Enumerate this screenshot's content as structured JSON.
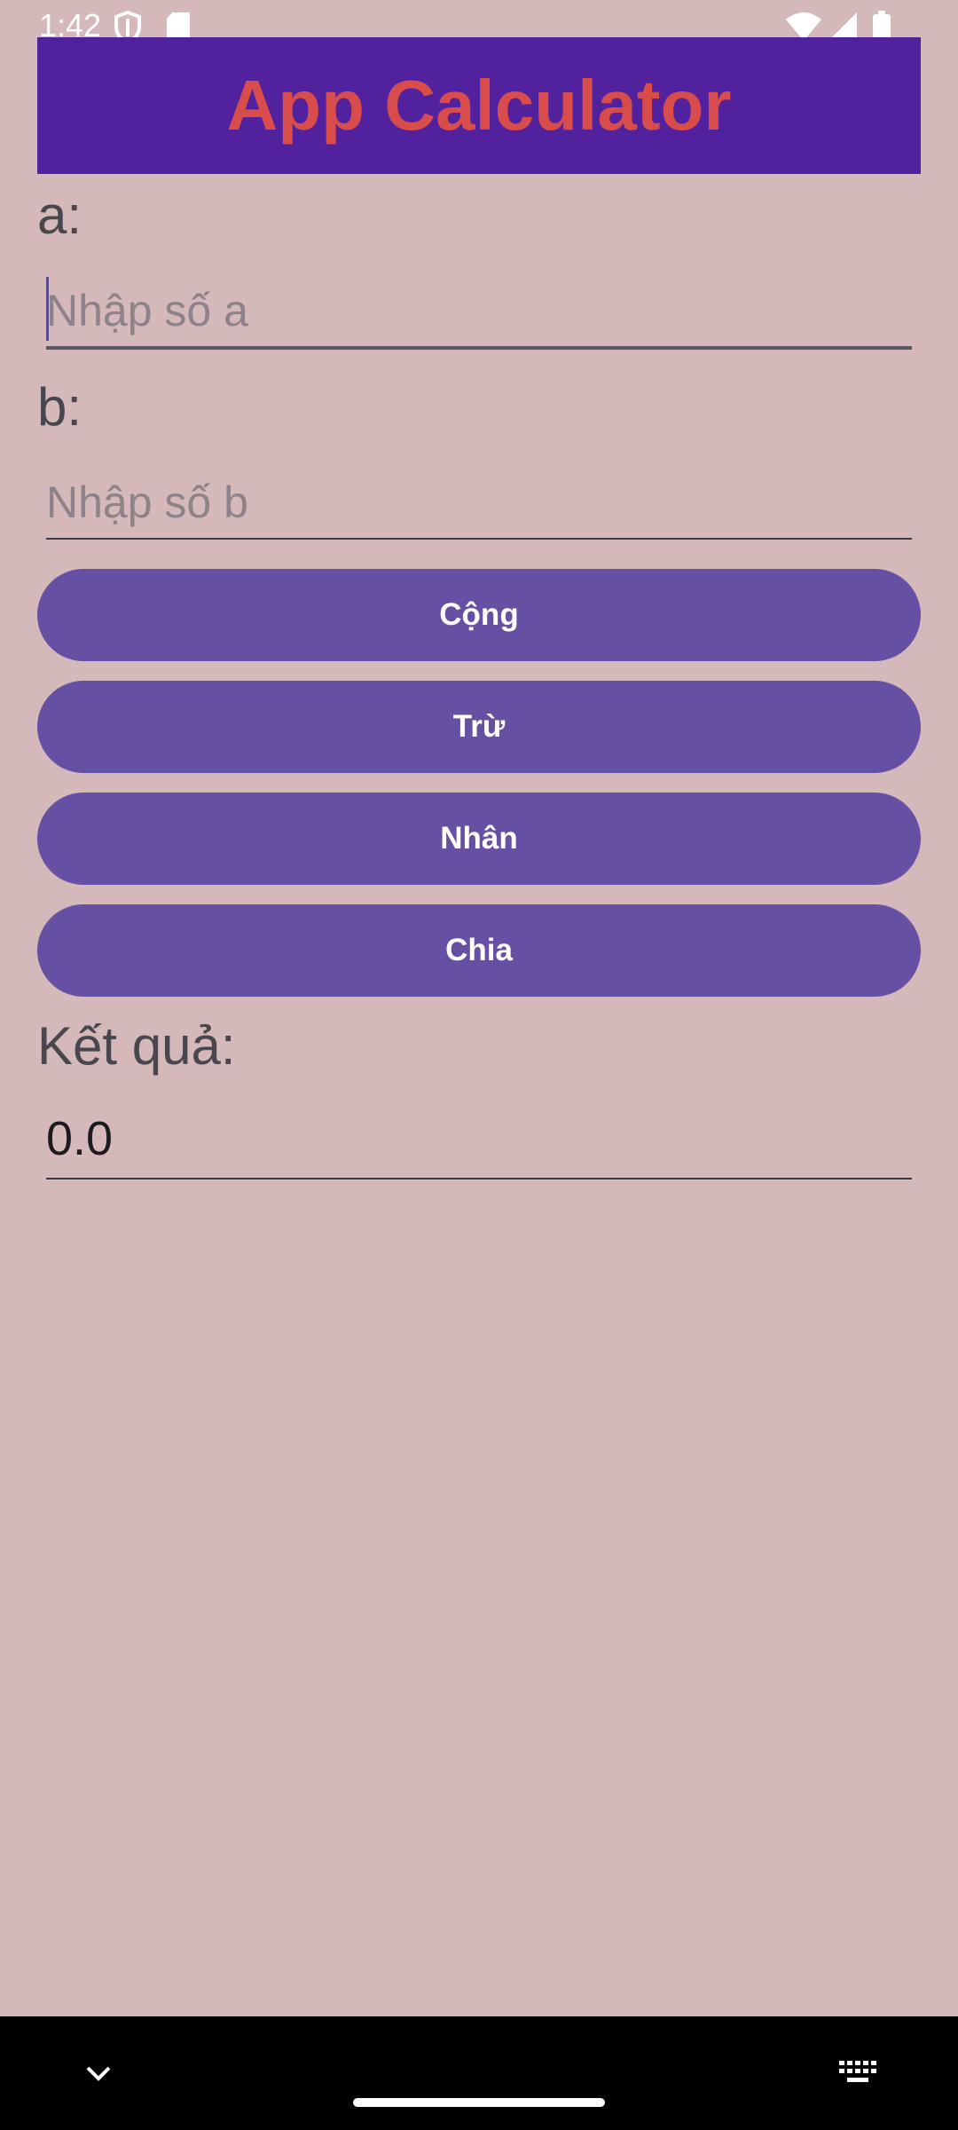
{
  "status_bar": {
    "time": "1:42",
    "icons": [
      "shield-icon",
      "sd-card-icon",
      "wifi-icon",
      "signal-icon",
      "battery-icon"
    ]
  },
  "app": {
    "title": "App Calculator",
    "field_a": {
      "label": "a:",
      "placeholder": "Nhập số a",
      "value": ""
    },
    "field_b": {
      "label": "b:",
      "placeholder": "Nhập số b",
      "value": ""
    },
    "buttons": {
      "add": "Cộng",
      "subtract": "Trừ",
      "multiply": "Nhân",
      "divide": "Chia"
    },
    "result": {
      "label": "Kết quả:",
      "value": "0.0"
    }
  },
  "nav_bar": {
    "icons": [
      "chevron-down-icon",
      "keyboard-icon"
    ]
  },
  "colors": {
    "background": "#d5b8b9",
    "title_bar": "#52219d",
    "title_text": "#d84c4c",
    "button": "#6650a4"
  }
}
